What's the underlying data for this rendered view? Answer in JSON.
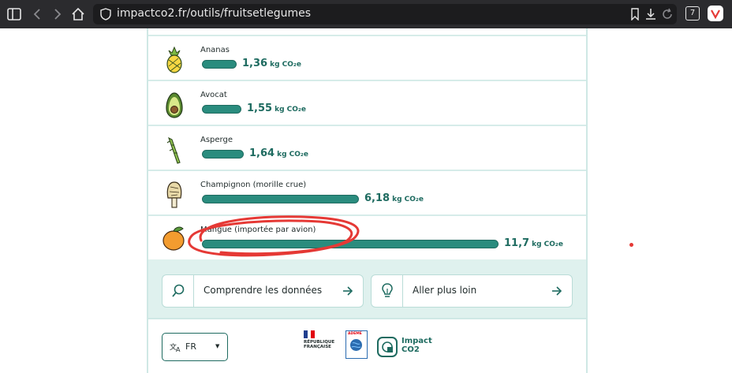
{
  "browser": {
    "url": "impactco2.fr/outils/fruitsetlegumes",
    "tab_count": "7"
  },
  "items": [
    {
      "name": "Ananas",
      "value": "1,36",
      "amount": 1.36,
      "unit": "kg CO₂e",
      "icon": "pineapple-icon"
    },
    {
      "name": "Avocat",
      "value": "1,55",
      "amount": 1.55,
      "unit": "kg CO₂e",
      "icon": "avocado-icon"
    },
    {
      "name": "Asperge",
      "value": "1,64",
      "amount": 1.64,
      "unit": "kg CO₂e",
      "icon": "asparagus-icon"
    },
    {
      "name": "Champignon (morille crue)",
      "value": "6,18",
      "amount": 6.18,
      "unit": "kg CO₂e",
      "icon": "morel-mushroom-icon"
    },
    {
      "name": "Mangue (importée par avion)",
      "value": "11,7",
      "amount": 11.7,
      "unit": "kg CO₂e",
      "icon": "mango-icon"
    }
  ],
  "actions": [
    {
      "label": "Comprendre les données",
      "icon": "magnifier-icon"
    },
    {
      "label": "Aller plus loin",
      "icon": "lightbulb-icon"
    }
  ],
  "footer": {
    "language": "FR",
    "rf_line1": "RÉPUBLIQUE",
    "rf_line2": "FRANÇAISE",
    "ademe": "ADEME",
    "impact_line1": "Impact",
    "impact_line2": "CO2"
  },
  "colors": {
    "bar": "#2a8c7e",
    "accent": "#1e6b60",
    "panel": "#dff1ee",
    "annotation": "#e53935"
  }
}
